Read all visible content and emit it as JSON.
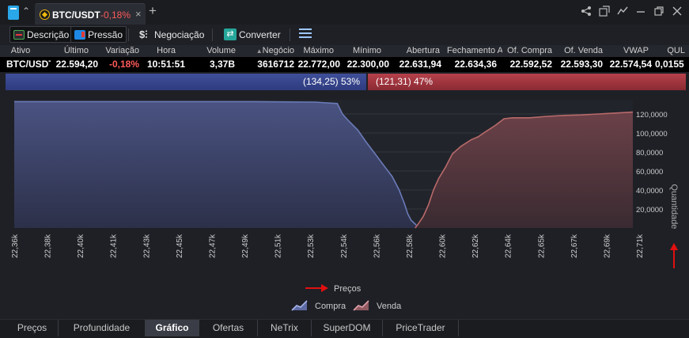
{
  "window": {
    "tab_symbol": "BTC/USDT",
    "tab_change": "-0,18%",
    "close_glyph": "×",
    "add_glyph": "+",
    "icons": [
      "share-icon",
      "popout-icon",
      "chart-link-icon",
      "minimize-icon",
      "restore-icon",
      "close-icon"
    ]
  },
  "toolbar": {
    "descricao": "Descrição",
    "pressao": "Pressão",
    "negociacao": "Negociação",
    "converter": "Converter"
  },
  "quote": {
    "headers": [
      "Ativo",
      "Último",
      "Variação",
      "Hora",
      "Volume",
      "Negócio",
      "Máximo",
      "Mínimo",
      "Abertura",
      "Fechamento A",
      "Of. Compra",
      "Of. Venda",
      "VWAP",
      "QUL"
    ],
    "row": [
      "BTC/USDT",
      "22.594,20",
      "-0,18%",
      "10:51:51",
      "3,37B",
      "3616712",
      "22.772,00",
      "22.300,00",
      "22.631,94",
      "22.634,36",
      "22.592,52",
      "22.593,30",
      "22.574,54",
      "0,0155"
    ]
  },
  "pressure": {
    "buy_label": "(134,25) 53%",
    "sell_label": "(121,31) 47%",
    "buy_fraction": 0.53,
    "colors": {
      "buy": "#3f4f9a",
      "sell": "#b6414b"
    }
  },
  "chart_data": {
    "type": "area",
    "ylabel": "Quantidade",
    "xlabel": "Preços",
    "x_ticks": [
      "22,36k",
      "22,38k",
      "22,40k",
      "22,41k",
      "22,43k",
      "22,45k",
      "22,47k",
      "22,49k",
      "22,51k",
      "22,53k",
      "22,54k",
      "22,56k",
      "22,58k",
      "22,60k",
      "22,62k",
      "22,64k",
      "22,65k",
      "22,67k",
      "22,69k",
      "22,71k"
    ],
    "y_ticks": [
      "20,0000",
      "40,0000",
      "60,0000",
      "80,0000",
      "100,0000",
      "120,0000"
    ],
    "ylim": [
      0,
      135
    ],
    "x_range": [
      22.36,
      22.72
    ],
    "series": [
      {
        "name": "Compra",
        "color": "#6a7bb8",
        "points": [
          [
            22.36,
            133
          ],
          [
            22.4,
            133
          ],
          [
            22.45,
            133
          ],
          [
            22.5,
            133
          ],
          [
            22.535,
            132.5
          ],
          [
            22.548,
            131
          ],
          [
            22.551,
            120
          ],
          [
            22.555,
            112
          ],
          [
            22.56,
            103
          ],
          [
            22.565,
            90
          ],
          [
            22.57,
            78
          ],
          [
            22.575,
            66
          ],
          [
            22.58,
            54
          ],
          [
            22.584,
            40
          ],
          [
            22.587,
            26
          ],
          [
            22.589,
            15
          ],
          [
            22.591,
            8
          ],
          [
            22.594,
            3
          ]
        ]
      },
      {
        "name": "Venda",
        "color": "#b86a6a",
        "points": [
          [
            22.5933,
            0
          ],
          [
            22.595,
            4
          ],
          [
            22.598,
            12
          ],
          [
            22.601,
            24
          ],
          [
            22.604,
            40
          ],
          [
            22.607,
            52
          ],
          [
            22.611,
            64
          ],
          [
            22.615,
            78
          ],
          [
            22.62,
            86
          ],
          [
            22.626,
            93
          ],
          [
            22.63,
            96
          ],
          [
            22.634,
            101
          ],
          [
            22.64,
            108
          ],
          [
            22.645,
            115
          ],
          [
            22.65,
            116
          ],
          [
            22.66,
            116
          ],
          [
            22.67,
            117.5
          ],
          [
            22.68,
            118.5
          ],
          [
            22.69,
            119
          ],
          [
            22.7,
            120
          ],
          [
            22.71,
            121
          ],
          [
            22.72,
            122
          ]
        ]
      }
    ],
    "legend": [
      "Compra",
      "Venda"
    ],
    "grid": true
  },
  "bottom_tabs": [
    "Preços",
    "Profundidade",
    "Gráfico",
    "Ofertas",
    "NeTrix",
    "SuperDOM",
    "PriceTrader"
  ],
  "active_tab": "Gráfico"
}
